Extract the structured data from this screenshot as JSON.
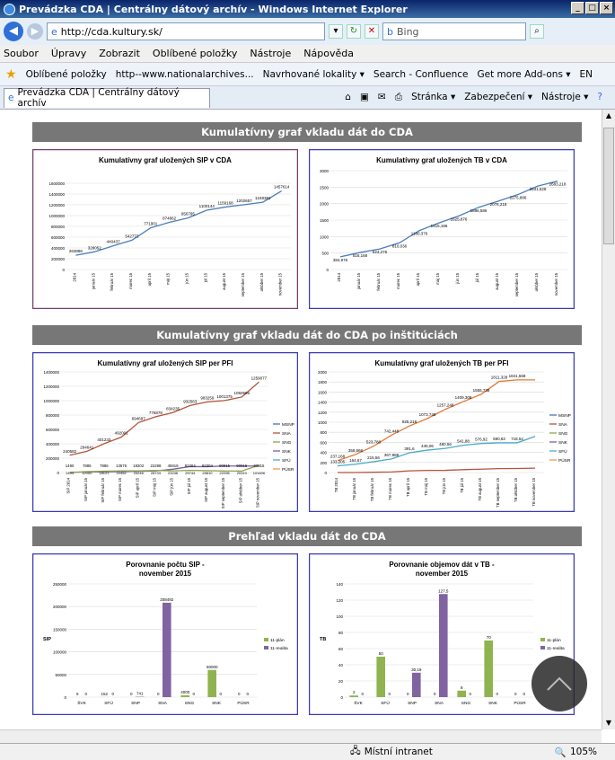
{
  "window": {
    "title": "Prevádzka CDA | Centrálny dátový archív - Windows Internet Explorer"
  },
  "address": {
    "url": "http://cda.kultury.sk/",
    "search_placeholder": "Bing"
  },
  "menu": [
    "Soubor",
    "Úpravy",
    "Zobrazit",
    "Oblíbené položky",
    "Nástroje",
    "Nápověda"
  ],
  "favorites": {
    "label": "Oblíbené položky",
    "items": [
      "http--www.nationalarchives...",
      "Navrhované lokality ▾",
      "Search - Confluence",
      "Get more Add-ons ▾",
      "EN"
    ]
  },
  "tab": {
    "title": "Prevádzka CDA | Centrálny dátový archív"
  },
  "tab_tools": [
    "Stránka ▾",
    "Zabezpečení ▾",
    "Nástroje ▾"
  ],
  "status": {
    "zone": "Místní intranet",
    "zoom": "105%"
  },
  "sections": {
    "s1": "Kumulatívny graf vkladu dát do CDA",
    "s2": "Kumulatívny graf vkladu dát do CDA po inštitúciách",
    "s3": "Prehľad vkladu dát do CDA"
  },
  "months": [
    "2014",
    "január 15",
    "február 15",
    "marec 15",
    "apríl 15",
    "máj 15",
    "jún 15",
    "júl 15",
    "august 15",
    "september 15",
    "október 15",
    "november 15"
  ],
  "chart_data": [
    {
      "type": "line",
      "title": "Kumulatívny graf uložených SIP v CDA",
      "xlabel": "",
      "ylabel": "",
      "ylim": [
        0,
        1600000
      ],
      "yticks": [
        0,
        200000,
        400000,
        600000,
        800000,
        1000000,
        1200000,
        1400000,
        1600000
      ],
      "series": [
        {
          "values": [
            263886,
            328052,
            440437,
            542772,
            771901,
            874862,
            956795,
            1100144,
            1159168,
            1202657,
            1248381,
            1457614
          ]
        }
      ],
      "labels": [
        "263886",
        "328052",
        "440437",
        "542772",
        "771901",
        "874862",
        "956795",
        "1100144",
        "1159168",
        "1202657",
        "1248381",
        "1457614"
      ]
    },
    {
      "type": "line",
      "title": "Kumulatívny graf uložených TB v CDA",
      "xlabel": "",
      "ylabel": "",
      "ylim": [
        0,
        3000
      ],
      "yticks": [
        0,
        500,
        1000,
        1500,
        2000,
        2500,
        3000
      ],
      "series": [
        {
          "values": [
            384.976,
            516.168,
            624.276,
            810.036,
            1180.376,
            1415.186,
            1625.876,
            1886.586,
            2076.218,
            2275.886,
            2531.528,
            2683.218
          ]
        }
      ],
      "labels": [
        "384,976",
        "516,168",
        "624,276",
        "810,036",
        "1180,376",
        "1415,186",
        "1625,876",
        "1886,586",
        "2076,218",
        "2275,886",
        "2531,528",
        "2683,218"
      ]
    },
    {
      "type": "line",
      "title": "Kumulatívny graf uložených SIP per PFI",
      "xlabel": "",
      "ylabel": "",
      "ylim": [
        0,
        1400000
      ],
      "yticks": [
        0,
        200000,
        400000,
        600000,
        800000,
        1000000,
        1200000,
        1400000
      ],
      "categories": [
        "SIP 2014",
        "SIP január 15",
        "SIP február 15",
        "SIP marec 15",
        "SIP apríl 15",
        "SIP máj 15",
        "SIP jún 15",
        "SIP júl 15",
        "SIP august 15",
        "SIP september 15",
        "SIP október 15",
        "SIP november 15"
      ],
      "legend": [
        "MSNP",
        "SNA",
        "SNG",
        "SNK",
        "SFÚ",
        "PÚSR"
      ],
      "series": [
        {
          "name": "SNA",
          "values": [
            240582,
            294641,
            401233,
            492001,
            694697,
            776878,
            834235,
            932563,
            983259,
            1001375,
            1050585,
            1259077
          ]
        },
        {
          "name": "SNK",
          "values": [
            1490,
            7885,
            7886,
            13575,
            18202,
            22298,
            45919,
            82304,
            82304,
            90915,
            90915,
            90915
          ]
        },
        {
          "name": "SNG",
          "values": [
            1493,
            12000,
            18121,
            22452,
            23246,
            28733,
            23246,
            29744,
            25810,
            22298,
            20310,
            101606
          ]
        }
      ],
      "labels_top": [
        "240582",
        "294641",
        "401233",
        "492001",
        "694697",
        "776878",
        "834235",
        "932563",
        "983259",
        "1001375",
        "1050585",
        "1259077"
      ],
      "labels_bottom": [
        "1490",
        "7885",
        "7886",
        "13575",
        "18202",
        "22298",
        "45919",
        "82304",
        "82304",
        "90915",
        "90915",
        "90915"
      ],
      "labels_bottom2": [
        "1493",
        "12000",
        "18121",
        "22452",
        "23246",
        "28733",
        "23246",
        "29744",
        "25810",
        "22298",
        "20310",
        "101606"
      ]
    },
    {
      "type": "line",
      "title": "Kumulatívny graf uložených TB per PFI",
      "xlabel": "",
      "ylabel": "",
      "ylim": [
        0,
        2000
      ],
      "yticks": [
        0,
        200,
        400,
        600,
        800,
        1000,
        1200,
        1400,
        1600,
        1800,
        2000
      ],
      "categories": [
        "TB 2014",
        "TB január 15",
        "TB február 15",
        "TB marec 15",
        "TB apríl 15",
        "TB máj 15",
        "TB jún 15",
        "TB júl 15",
        "TB august 15",
        "TB september 15",
        "TB október 15",
        "TB november 15"
      ],
      "legend": [
        "MSNP",
        "SNA",
        "SNG",
        "SNK",
        "SFÚ",
        "PÚSR"
      ],
      "series": [
        {
          "name": "SNA",
          "values": [
            237.168,
            358.666,
            523.788,
            742.448,
            925.218,
            1073.748,
            1257.248,
            1409.308,
            1555.738,
            1811.328,
            1841.568,
            1841.568
          ]
        },
        {
          "name": "SNK",
          "values": [
            133.205,
            164.67,
            215.56,
            270.08,
            391.6,
            445.06,
            480.56,
            541.88,
            576.92,
            590.82,
            590.82,
            718.52
          ]
        },
        {
          "name": "SFÚ",
          "values": [
            0,
            0,
            5.17,
            11.55,
            32.92,
            42.88,
            43.75,
            57.02,
            67.12,
            78.35,
            80.4,
            86.4
          ]
        }
      ],
      "labels_top": [
        "237,168",
        "358,666",
        "523,788",
        "742,448",
        "925,218",
        "1073,748",
        "1257,248",
        "1409,308",
        "1555,738",
        "1811,328",
        "1841,568"
      ],
      "labels_mid": [
        "133,205",
        "164,67",
        "215,56",
        "367,888",
        "391,6",
        "445,06",
        "480,56",
        "541,88",
        "576,92",
        "590,82",
        "718,52"
      ]
    },
    {
      "type": "bar",
      "title": "Porovnanie počtu SIP - november 2015",
      "ylabel": "SIP",
      "ylim": [
        0,
        250000
      ],
      "yticks": [
        0,
        50000,
        100000,
        150000,
        200000,
        250000
      ],
      "categories": [
        "ŠVK",
        "SFÚ",
        "SNP",
        "SNA",
        "SNG",
        "SNK",
        "PÚSR"
      ],
      "series": [
        {
          "name": "11-plán",
          "values": [
            5,
            152,
            0,
            0,
            4000,
            60000,
            0
          ]
        },
        {
          "name": "11-realita",
          "values": [
            0,
            0,
            741,
            208492,
            0,
            0,
            0
          ]
        }
      ]
    },
    {
      "type": "bar",
      "title": "Porovnanie objemov dát v TB - november 2015",
      "ylabel": "TB",
      "ylim": [
        0,
        140
      ],
      "yticks": [
        0,
        20,
        40,
        60,
        80,
        100,
        120,
        140
      ],
      "categories": [
        "ŠVK",
        "SFÚ",
        "SNP",
        "SNA",
        "SNG",
        "SNK",
        "PÚSR"
      ],
      "series": [
        {
          "name": "11-plán",
          "values": [
            2,
            50,
            0,
            0,
            8,
            70,
            0
          ]
        },
        {
          "name": "11-realita",
          "values": [
            0,
            0,
            30.19,
            127.5,
            0,
            0,
            0
          ]
        }
      ],
      "labels": {
        "11-plán": [
          "2",
          "50",
          "0",
          "0",
          "8",
          "70",
          "0"
        ],
        "11-realita": [
          "0",
          "0",
          "30,19",
          "127,5",
          "0",
          "0",
          "0"
        ]
      }
    }
  ],
  "colors": {
    "sna": "#b5533c",
    "sng": "#8ba64b",
    "snk": "#7e5ea6",
    "msnp": "#4a74b0",
    "sfu": "#4bacc6",
    "pusr": "#f79646",
    "line": "#4a7ebb",
    "plan": "#8fb34f",
    "realita": "#8064a2",
    "section": "#777777"
  }
}
